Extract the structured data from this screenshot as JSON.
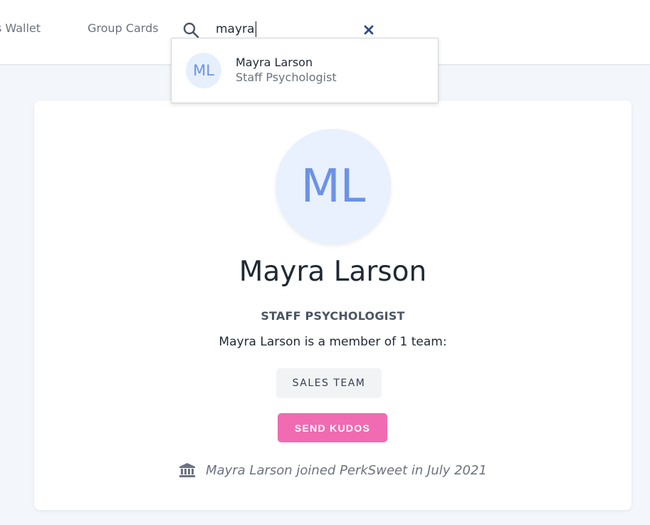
{
  "nav": {
    "wallet_label": "s Wallet",
    "group_cards_label": "Group Cards"
  },
  "search": {
    "value": "mayra",
    "icon": "search-icon",
    "clear_icon": "close-icon"
  },
  "search_results": [
    {
      "initials": "ML",
      "name": "Mayra Larson",
      "title": "Staff Psychologist"
    }
  ],
  "profile": {
    "initials": "ML",
    "name": "Mayra Larson",
    "title": "STAFF PSYCHOLOGIST",
    "team_text": "Mayra Larson is a member of 1 team:",
    "teams": [
      "SALES TEAM"
    ],
    "send_kudos_label": "SEND KUDOS",
    "joined_text": "Mayra Larson joined PerkSweet in July 2021",
    "joined_icon": "bank-icon"
  },
  "colors": {
    "accent_pink": "#f06bb1",
    "avatar_text": "#6d92e6",
    "avatar_bg": "#e8f1fd",
    "clear_icon": "#2f4d86",
    "page_bg": "#f3f7fc"
  }
}
